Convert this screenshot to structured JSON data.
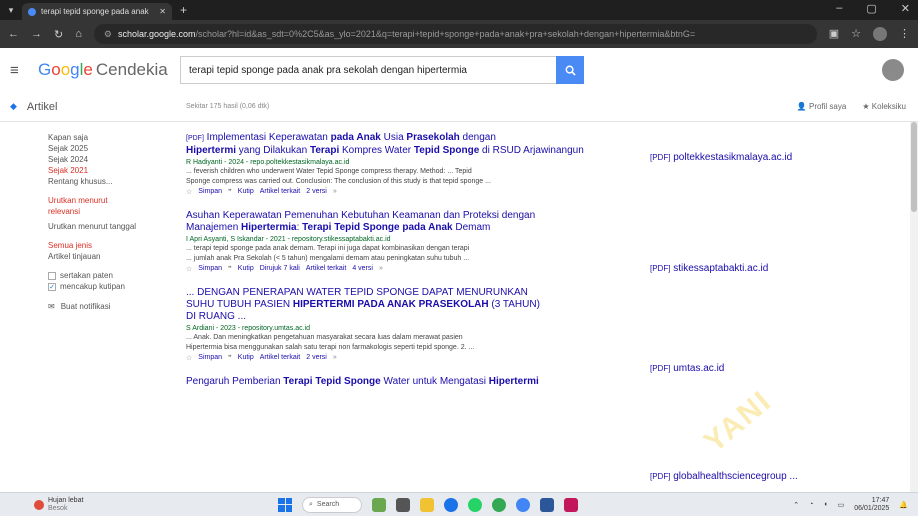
{
  "browser": {
    "tab_title": "terapi tepid sponge pada anak",
    "url_domain": "scholar.google.com",
    "url_path": "/scholar?hl=id&as_sdt=0%2C5&as_ylo=2021&q=terapi+tepid+sponge+pada+anak+pra+sekolah+dengan+hipertermia&btnG="
  },
  "header": {
    "logo_google": [
      "G",
      "o",
      "o",
      "g",
      "l",
      "e"
    ],
    "logo_suffix": "Cendekia",
    "search_value": "terapi tepid sponge pada anak pra sekolah dengan hipertermia"
  },
  "subbar": {
    "section": "Artikel",
    "stats": "Sekitar 175 hasil (0,06 dtk)",
    "profile_link": "Profil saya",
    "library_link": "Koleksiku"
  },
  "sidebar": {
    "time_items": [
      "Kapan saja",
      "Sejak 2025",
      "Sejak 2024",
      "Sejak 2021",
      "Rentang khusus..."
    ],
    "sort_items": [
      "Urutkan menurut relevansi",
      "Urutkan menurut tanggal"
    ],
    "type_items": [
      "Semua jenis",
      "Artikel tinjauan"
    ],
    "patents_label": "sertakan paten",
    "citations_label": "mencakup kutipan",
    "notif_label": "Buat notifikasi"
  },
  "results": [
    {
      "pdf_tag": "[PDF]",
      "title_pre": "Implementasi Keperawatan ",
      "title_b1": "pada Anak",
      "title_mid": " Usia ",
      "title_b2": "Prasekolah",
      "title_post": " dengan ",
      "title_line2_b": "Hipertermi",
      "title_line2": " yang Dilakukan ",
      "title_line2_b2": "Terapi",
      "title_line2_post": " Kompres Water ",
      "title_line2_b3": "Tepid Sponge",
      "title_line2_end": " di RSUD Arjawinangun",
      "meta": "R Hadiyanti - 2024 - repo.poltekkestasikmalaya.ac.id",
      "snippet1": "... feverish children who underwent Water Tepid Sponge compress therapy. Method: ... Tepid",
      "snippet2": "Sponge compress was carried out. Conclusion: The conclusion of this study is that tepid sponge ...",
      "actions": [
        "Simpan",
        "Kutip",
        "Artikel terkait",
        "2 versi"
      ],
      "side_tag": "[PDF]",
      "side_domain": "poltekkestasikmalaya.ac.id"
    },
    {
      "title_line1": "Asuhan Keperawatan Pemenuhan Kebutuhan Keamanan dan Proteksi dengan",
      "title_line2_pre": "Manajemen ",
      "title_line2_b": "Hipertermia",
      "title_line2_mid": ": ",
      "title_line2_b2": "Terapi Tepid Sponge pada Anak",
      "title_line2_end": " Demam",
      "meta": "I Apri Asyanti, S Iskandar - 2021 - repository.stikessaptabakti.ac.id",
      "snippet1": "... terapi tepid sponge pada anak demam. Terapi ini juga dapat kombinasikan dengan terapi",
      "snippet2": "... jumlah anak Pra Sekolah (< 5 tahun) mengalami demam atau peningkatan suhu tubuh ...",
      "actions": [
        "Simpan",
        "Kutip",
        "Dirujuk 7 kali",
        "Artikel terkait",
        "4 versi"
      ],
      "side_tag": "[PDF]",
      "side_domain": "stikessaptabakti.ac.id"
    },
    {
      "title_line1": "... DENGAN PENERAPAN WATER TEPID SPONGE DAPAT MENURUNKAN",
      "title_line2_pre": "SUHU TUBUH PASIEN ",
      "title_line2_b": "HIPERTERMI PADA ANAK PRASEKOLAH",
      "title_line2_end": " (3 TAHUN)",
      "title_line3": "DI RUANG ...",
      "meta": "S Ardiani - 2023 - repository.umtas.ac.id",
      "snippet1": "... Anak. Dan meningkatkan pengetahuan masyarakat secara luas dalam merawat pasien",
      "snippet2": "Hipertermia bisa menggunakan salah satu terapi non farmakologis seperti tepid sponge. 2. ...",
      "actions": [
        "Simpan",
        "Kutip",
        "Artikel terkait",
        "2 versi"
      ],
      "side_tag": "[PDF]",
      "side_domain": "umtas.ac.id"
    },
    {
      "title_pre": "Pengaruh Pemberian ",
      "title_b": "Terapi Tepid Sponge",
      "title_mid": " Water untuk Mengatasi ",
      "title_b2": "Hipertermi",
      "side_tag": "[PDF]",
      "side_domain": "globalhealthsciencegroup ..."
    }
  ],
  "taskbar": {
    "weather_line1": "Hujan lebat",
    "weather_line2": "Besok",
    "search_label": "Search",
    "time": "17:47",
    "date": "06/01/2025"
  },
  "watermark": "YANI"
}
